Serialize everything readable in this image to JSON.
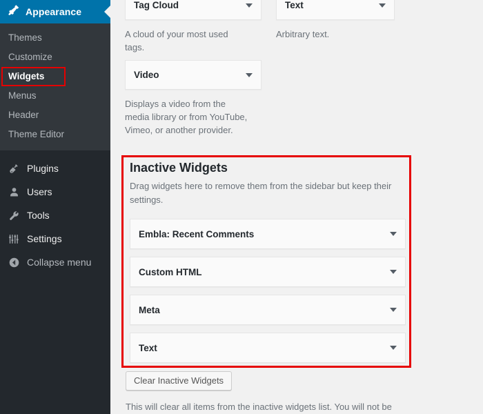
{
  "sidebar": {
    "current_section": {
      "label": "Appearance",
      "icon": "appearance-brush-icon",
      "accent_color": "#0073aa",
      "submenu": [
        {
          "label": "Themes",
          "current": false
        },
        {
          "label": "Customize",
          "current": false
        },
        {
          "label": "Widgets",
          "current": true
        },
        {
          "label": "Menus",
          "current": false
        },
        {
          "label": "Header",
          "current": false
        },
        {
          "label": "Theme Editor",
          "current": false
        }
      ]
    },
    "items": [
      {
        "label": "Plugins",
        "icon": "plugin-icon"
      },
      {
        "label": "Users",
        "icon": "user-icon"
      },
      {
        "label": "Tools",
        "icon": "wrench-icon"
      },
      {
        "label": "Settings",
        "icon": "sliders-icon"
      }
    ],
    "collapse": {
      "label": "Collapse menu",
      "icon": "collapse-left-arrow-icon"
    },
    "background_color": "#23282d",
    "submenu_background_color": "#32373c"
  },
  "highlights": {
    "color": "#e60000",
    "widgets_menu": true,
    "inactive_widgets_panel": true
  },
  "available_widgets": [
    {
      "title": "Tag Cloud",
      "description": "A cloud of your most used tags."
    },
    {
      "title": "Text",
      "description": "Arbitrary text."
    },
    {
      "title": "Video",
      "description": "Displays a video from the media library or from YouTube, Vimeo, or another provider."
    }
  ],
  "inactive_widgets": {
    "title": "Inactive Widgets",
    "description": "Drag widgets here to remove them from the sidebar but keep their settings.",
    "items": [
      {
        "title": "Embla: Recent Comments"
      },
      {
        "title": "Custom HTML"
      },
      {
        "title": "Meta"
      },
      {
        "title": "Text"
      }
    ],
    "clear_button_label": "Clear Inactive Widgets",
    "clear_note": "This will clear all items from the inactive widgets list. You will not be"
  }
}
